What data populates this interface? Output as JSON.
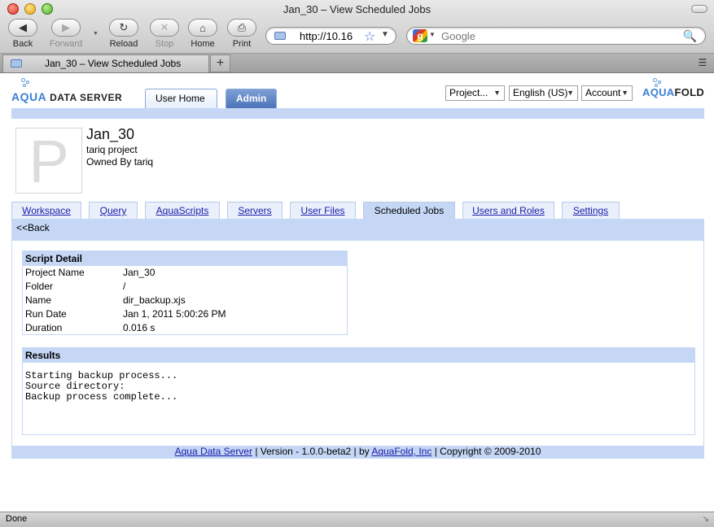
{
  "window": {
    "title": "Jan_30 – View Scheduled Jobs"
  },
  "toolbar": {
    "back": "Back",
    "forward": "Forward",
    "reload": "Reload",
    "stop": "Stop",
    "home": "Home",
    "print": "Print"
  },
  "url": {
    "value": "http://10.16"
  },
  "search": {
    "placeholder": "Google"
  },
  "browser_tab": {
    "title": "Jan_30 – View Scheduled Jobs",
    "new_tab": "+"
  },
  "header": {
    "logo_left_aqua": "AQUA",
    "logo_left_rest": " DATA SERVER",
    "logo_right_aqua": "AQUA",
    "logo_right_rest": "FOLD",
    "tabs": [
      "User Home",
      "Admin"
    ],
    "dropdowns": [
      "Project...",
      "English (US)",
      "Account"
    ]
  },
  "project": {
    "initial": "P",
    "name": "Jan_30",
    "description": "tariq project",
    "owner": "Owned By tariq"
  },
  "project_tabs": [
    "Workspace",
    "Query",
    "AquaScripts",
    "Servers",
    "User Files",
    "Scheduled Jobs",
    "Users and Roles",
    "Settings"
  ],
  "back_link": "<<Back",
  "script_detail": {
    "heading": "Script Detail",
    "rows": [
      {
        "label": "Project Name",
        "value": "Jan_30"
      },
      {
        "label": "Folder",
        "value": "/"
      },
      {
        "label": "Name",
        "value": "dir_backup.xjs"
      },
      {
        "label": "Run Date",
        "value": "Jan 1, 2011 5:00:26 PM"
      },
      {
        "label": "Duration",
        "value": "0.016 s"
      }
    ]
  },
  "results": {
    "heading": "Results",
    "output": "Starting backup process...\nSource directory:\nBackup process complete..."
  },
  "footer": {
    "link1": "Aqua Data Server",
    "version": " | Version - 1.0.0-beta2 | by ",
    "link2": "AquaFold, Inc",
    "copyright": " | Copyright © 2009-2010"
  },
  "status": {
    "text": "Done"
  },
  "colors": {
    "accent": "#c5d7f5",
    "link": "#1a1aa8",
    "logo": "#3a7fd5"
  }
}
